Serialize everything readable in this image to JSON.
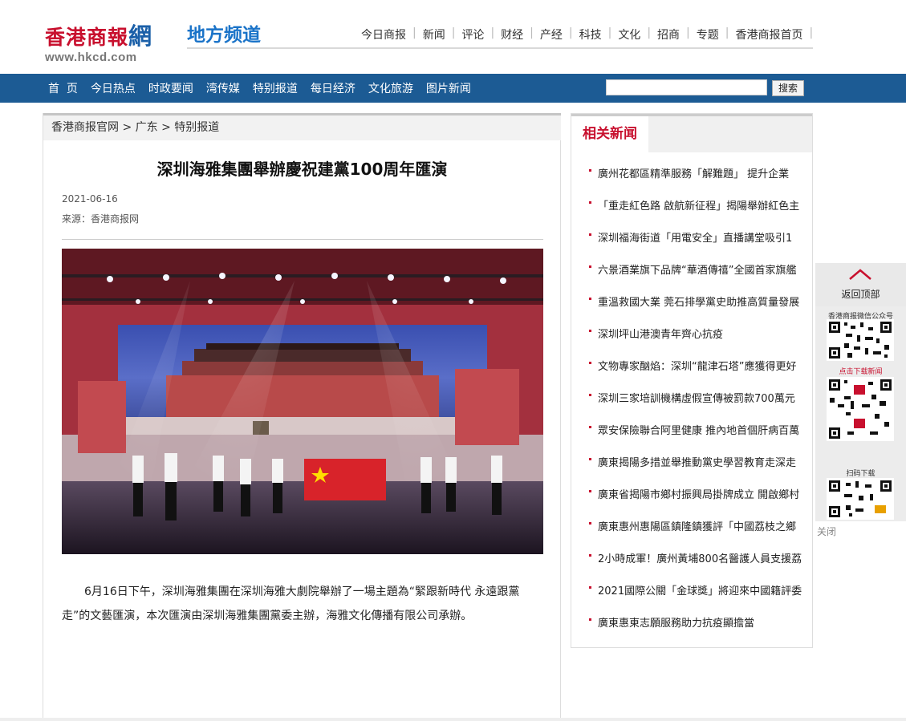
{
  "header": {
    "logo_text": "香港商報",
    "logo_wang": "網",
    "logo_url": "www.hkcd.com",
    "channel": "地方频道",
    "topnav": [
      "今日商报",
      "新闻",
      "评论",
      "财经",
      "产经",
      "科技",
      "文化",
      "招商",
      "专题",
      "香港商报首页"
    ]
  },
  "navbar": {
    "items": [
      "首  页",
      "今日热点",
      "时政要闻",
      "湾传媒",
      "特别报道",
      "每日经济",
      "文化旅游",
      "图片新闻"
    ],
    "search_value": "",
    "search_button": "搜索"
  },
  "article": {
    "breadcrumb": "香港商报官网 > 广东 > 特别报道",
    "title": "深圳海雅集團舉辦慶祝建黨100周年匯演",
    "date": "2021-06-16",
    "source": "来源：香港商报网",
    "photo_desc": "stage-performance-photo",
    "body": "6月16日下午，深圳海雅集團在深圳海雅大劇院舉辦了一場主題為“緊跟新時代 永遠跟黨走”的文藝匯演，本次匯演由深圳海雅集團黨委主辦，海雅文化傳播有限公司承辦。"
  },
  "sidebar": {
    "tab": "相关新闻",
    "news": [
      "廣州花都區精準服務「解難題」 提升企業",
      "「重走紅色路 啟航新征程」揭陽舉辦紅色主",
      "深圳福海街道「用電安全」直播講堂吸引1",
      "六景酒業旗下品牌“華酒傳禧”全國首家旗艦",
      "重溫救國大業 莞石排學黨史助推高質量發展",
      "深圳坪山港澳青年齊心抗疫",
      "文物專家酗焰：深圳“龍津石塔”應獲得更好",
      "深圳三家培訓機構虛假宣傳被罰款700萬元",
      "眾安保險聯合阿里健康 推內地首個肝病百萬",
      "廣東揭陽多措並舉推動黨史學習教育走深走",
      "廣東省揭陽市鄉村振興局掛牌成立 開啟鄉村",
      "廣東惠州惠陽區鎮隆鎮獲評「中國荔枝之鄉",
      "2小時成軍！廣州黃埔800名醫護人員支援荔",
      "2021國際公關「金球獎」將迎來中國籍評委",
      "廣東惠東志願服務助力抗疫顯擔當"
    ]
  },
  "floating": {
    "back_top": "返回顶部",
    "qr_captions": [
      "香港商报微信公众号",
      "点击下载新闻",
      "扫码下载"
    ],
    "close": "关闭"
  }
}
